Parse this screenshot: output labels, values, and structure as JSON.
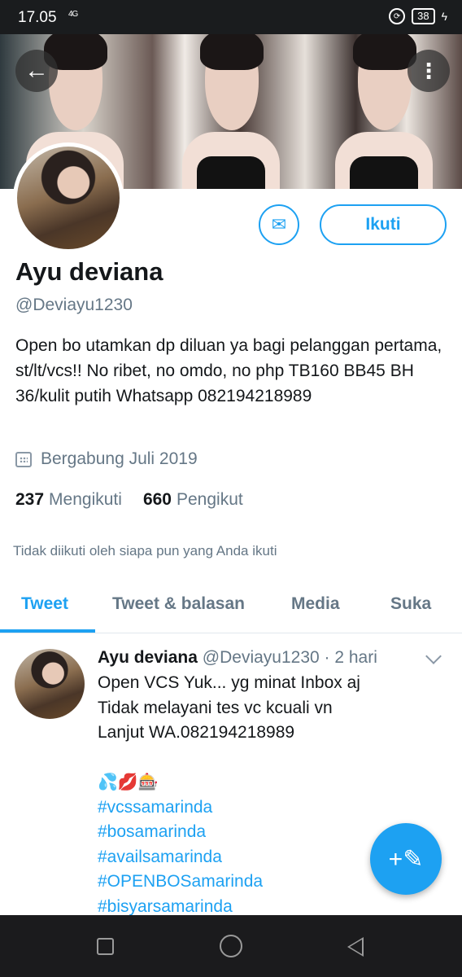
{
  "status_bar": {
    "time": "17.05",
    "signal": "4G",
    "battery": "38"
  },
  "profile": {
    "display_name": "Ayu deviana",
    "handle": "@Deviayu1230",
    "bio": "Open bo utamkan dp diluan ya bagi pelanggan pertama, st/lt/vcs!!  No ribet, no omdo, no php  TB160 BB45 BH 36/kulit putih Whatsapp 082194218989",
    "joined": "Bergabung Juli 2019",
    "following_count": "237",
    "following_label": "Mengikuti",
    "followers_count": "660",
    "followers_label": "Pengikut",
    "followed_by_text": "Tidak diikuti oleh siapa pun yang Anda ikuti",
    "follow_button": "Ikuti"
  },
  "tabs": [
    {
      "label": "Tweet",
      "active": true
    },
    {
      "label": "Tweet & balasan",
      "active": false
    },
    {
      "label": "Media",
      "active": false
    },
    {
      "label": "Suka",
      "active": false
    }
  ],
  "tweet": {
    "name": "Ayu deviana",
    "meta": "@Deviayu1230 · 2 hari",
    "lines": [
      "Open VCS  Yuk... yg minat Inbox aj",
      "Tidak melayani tes vc kcuali vn",
      "Lanjut WA.082194218989"
    ],
    "emojis": "💦💋🎰",
    "hashtags": [
      "#vcssamarinda",
      "#bosamarinda",
      "#availsamarinda",
      "#OPENBOSamarinda",
      "#bisyarsamarinda"
    ]
  },
  "icons": {
    "back": "arrow-left",
    "more": "vertical-ellipsis",
    "message": "envelope",
    "calendar": "calendar",
    "compose": "feather-plus"
  },
  "colors": {
    "accent": "#1da1f2",
    "secondary_text": "#657786"
  }
}
